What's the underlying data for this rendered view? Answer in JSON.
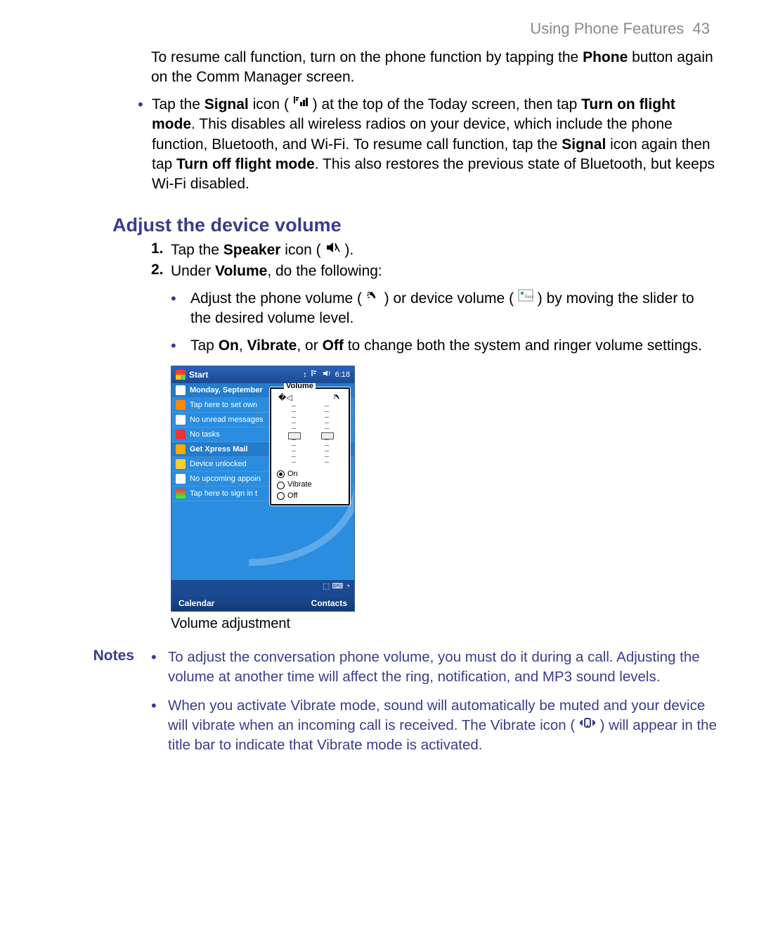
{
  "header": {
    "section": "Using Phone Features",
    "page_number": "43"
  },
  "intro": {
    "pre": "To resume call function, turn on the phone function by tapping the ",
    "bold": "Phone",
    "post": " button again on the Comm Manager screen."
  },
  "bullet1": {
    "p1a": "Tap the ",
    "p1b": "Signal",
    "p1c": " icon ( ",
    "p1d": " ) at the top of the Today screen, then tap ",
    "p1e": "Turn on flight mode",
    "p1f": ". This disables all wireless radios on your device, which include the phone function, Bluetooth, and Wi-Fi. To resume call function, tap the ",
    "p1g": "Signal",
    "p1h": " icon again then tap ",
    "p1i": "Turn off flight mode",
    "p1j": ". This also restores the previous state of Bluetooth, but keeps Wi-Fi disabled."
  },
  "heading": "Adjust the device volume",
  "ol": {
    "n1": "1.",
    "n2": "2.",
    "i1a": "Tap the ",
    "i1b": "Speaker",
    "i1c": " icon ( ",
    "i1d": " ).",
    "i2a": "Under ",
    "i2b": "Volume",
    "i2c": ", do the following:"
  },
  "sub": {
    "s1a": "Adjust the phone volume ( ",
    "s1b": " ) or device volume ( ",
    "s1c": " ) by moving the slider to the desired volume level.",
    "s2a": "Tap ",
    "s2b": "On",
    "s2c": ", ",
    "s2d": "Vibrate",
    "s2e": ", or ",
    "s2f": "Off",
    "s2g": " to change both the system and ringer volume settings."
  },
  "screenshot": {
    "start": "Start",
    "time": "6:18",
    "date": "Monday, September",
    "rows": {
      "owner": "Tap here to set own",
      "messages": "No unread messages",
      "tasks": "No tasks",
      "xpress": "Get Xpress Mail",
      "unlocked": "Device unlocked",
      "appoint": "No upcoming appoin",
      "signin": "Tap here to sign in t"
    },
    "popup_title": "Volume",
    "radios": {
      "on": "On",
      "vibrate": "Vibrate",
      "off": "Off"
    },
    "soft_left": "Calendar",
    "soft_right": "Contacts"
  },
  "caption": "Volume adjustment",
  "notes": {
    "label": "Notes",
    "n1": "To adjust the conversation phone volume, you must do it during a call. Adjusting the volume at another time will affect the ring, notification, and MP3 sound levels.",
    "n2a": "When you activate Vibrate mode, sound will automatically be muted and your device will vibrate when an incoming call is received. The Vibrate icon ( ",
    "n2b": " ) will appear in the title bar to indicate that Vibrate mode is activated."
  }
}
